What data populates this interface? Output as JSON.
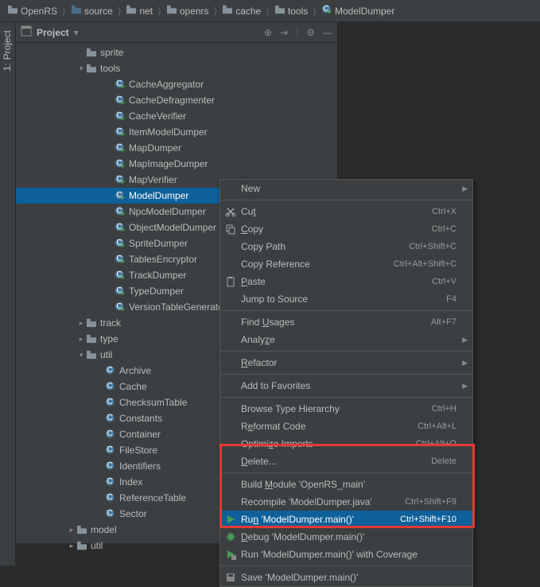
{
  "breadcrumb": [
    {
      "icon": "folder",
      "label": "OpenRS"
    },
    {
      "icon": "folder-src",
      "label": "source"
    },
    {
      "icon": "folder",
      "label": "net"
    },
    {
      "icon": "folder",
      "label": "openrs"
    },
    {
      "icon": "folder",
      "label": "cache"
    },
    {
      "icon": "folder",
      "label": "tools"
    },
    {
      "icon": "class-run",
      "label": "ModelDumper"
    }
  ],
  "sidebar_tab": {
    "index": "1:",
    "label": "Project"
  },
  "panel": {
    "title": "Project"
  },
  "tree": [
    {
      "indent": 76,
      "expand": "",
      "icon": "folder",
      "label": "sprite",
      "sel": false
    },
    {
      "indent": 76,
      "expand": "▾",
      "icon": "folder",
      "label": "tools",
      "sel": false
    },
    {
      "indent": 112,
      "expand": "",
      "icon": "class-run",
      "label": "CacheAggregator",
      "sel": false
    },
    {
      "indent": 112,
      "expand": "",
      "icon": "class-run",
      "label": "CacheDefragmenter",
      "sel": false
    },
    {
      "indent": 112,
      "expand": "",
      "icon": "class-run",
      "label": "CacheVerifier",
      "sel": false
    },
    {
      "indent": 112,
      "expand": "",
      "icon": "class-run",
      "label": "ItemModelDumper",
      "sel": false
    },
    {
      "indent": 112,
      "expand": "",
      "icon": "class-run",
      "label": "MapDumper",
      "sel": false
    },
    {
      "indent": 112,
      "expand": "",
      "icon": "class-run",
      "label": "MapImageDumper",
      "sel": false
    },
    {
      "indent": 112,
      "expand": "",
      "icon": "class-run",
      "label": "MapVerifier",
      "sel": false
    },
    {
      "indent": 112,
      "expand": "",
      "icon": "class-run",
      "label": "ModelDumper",
      "sel": true
    },
    {
      "indent": 112,
      "expand": "",
      "icon": "class-run",
      "label": "NpcModelDumper",
      "sel": false
    },
    {
      "indent": 112,
      "expand": "",
      "icon": "class-run",
      "label": "ObjectModelDumper",
      "sel": false
    },
    {
      "indent": 112,
      "expand": "",
      "icon": "class-run",
      "label": "SpriteDumper",
      "sel": false
    },
    {
      "indent": 112,
      "expand": "",
      "icon": "class-run",
      "label": "TablesEncryptor",
      "sel": false
    },
    {
      "indent": 112,
      "expand": "",
      "icon": "class-run",
      "label": "TrackDumper",
      "sel": false
    },
    {
      "indent": 112,
      "expand": "",
      "icon": "class-run",
      "label": "TypeDumper",
      "sel": false
    },
    {
      "indent": 112,
      "expand": "",
      "icon": "class-run",
      "label": "VersionTableGenerator",
      "sel": false
    },
    {
      "indent": 76,
      "expand": "▸",
      "icon": "folder",
      "label": "track",
      "sel": false
    },
    {
      "indent": 76,
      "expand": "▸",
      "icon": "folder",
      "label": "type",
      "sel": false
    },
    {
      "indent": 76,
      "expand": "▾",
      "icon": "folder",
      "label": "util",
      "sel": false
    },
    {
      "indent": 100,
      "expand": "",
      "icon": "class",
      "label": "Archive",
      "sel": false
    },
    {
      "indent": 100,
      "expand": "",
      "icon": "class",
      "label": "Cache",
      "sel": false
    },
    {
      "indent": 100,
      "expand": "",
      "icon": "class",
      "label": "ChecksumTable",
      "sel": false
    },
    {
      "indent": 100,
      "expand": "",
      "icon": "class",
      "label": "Constants",
      "sel": false
    },
    {
      "indent": 100,
      "expand": "",
      "icon": "class",
      "label": "Container",
      "sel": false
    },
    {
      "indent": 100,
      "expand": "",
      "icon": "class",
      "label": "FileStore",
      "sel": false
    },
    {
      "indent": 100,
      "expand": "",
      "icon": "class",
      "label": "Identifiers",
      "sel": false
    },
    {
      "indent": 100,
      "expand": "",
      "icon": "class",
      "label": "Index",
      "sel": false
    },
    {
      "indent": 100,
      "expand": "",
      "icon": "class",
      "label": "ReferenceTable",
      "sel": false
    },
    {
      "indent": 100,
      "expand": "",
      "icon": "class",
      "label": "Sector",
      "sel": false
    },
    {
      "indent": 64,
      "expand": "▸",
      "icon": "folder",
      "label": "model",
      "sel": false
    },
    {
      "indent": 64,
      "expand": "▸",
      "icon": "folder",
      "label": "util",
      "sel": false
    }
  ],
  "context_menu": [
    {
      "type": "item",
      "label": "New",
      "submenu": true
    },
    {
      "type": "sep"
    },
    {
      "type": "item",
      "icon": "cut",
      "label_html": "Cu<u>t</u>",
      "shortcut": "Ctrl+X"
    },
    {
      "type": "item",
      "icon": "copy",
      "label_html": "<u>C</u>opy",
      "shortcut": "Ctrl+C"
    },
    {
      "type": "item",
      "label": "Copy Path",
      "shortcut": "Ctrl+Shift+C"
    },
    {
      "type": "item",
      "label": "Copy Reference",
      "shortcut": "Ctrl+Alt+Shift+C"
    },
    {
      "type": "item",
      "icon": "paste",
      "label_html": "<u>P</u>aste",
      "shortcut": "Ctrl+V"
    },
    {
      "type": "item",
      "label": "Jump to Source",
      "shortcut": "F4"
    },
    {
      "type": "sep"
    },
    {
      "type": "item",
      "label_html": "Find <u>U</u>sages",
      "shortcut": "Alt+F7"
    },
    {
      "type": "item",
      "label_html": "Analy<u>z</u>e",
      "submenu": true
    },
    {
      "type": "sep"
    },
    {
      "type": "item",
      "label_html": "<u>R</u>efactor",
      "submenu": true
    },
    {
      "type": "sep"
    },
    {
      "type": "item",
      "label": "Add to Favorites",
      "submenu": true
    },
    {
      "type": "sep"
    },
    {
      "type": "item",
      "label": "Browse Type Hierarchy",
      "shortcut": "Ctrl+H"
    },
    {
      "type": "item",
      "label_html": "R<u>e</u>format Code",
      "shortcut": "Ctrl+Alt+L"
    },
    {
      "type": "item",
      "label_html": "Optimi<u>z</u>e Imports",
      "shortcut": "Ctrl+Alt+O"
    },
    {
      "type": "item",
      "label_html": "<u>D</u>elete...",
      "shortcut": "Delete"
    },
    {
      "type": "sep"
    },
    {
      "type": "item",
      "label_html": "Build <u>M</u>odule 'OpenRS_main'"
    },
    {
      "type": "item",
      "label": "Recompile 'ModelDumper.java'",
      "shortcut": "Ctrl+Shift+F9"
    },
    {
      "type": "item",
      "icon": "run",
      "label_html": "Ru<u>n</u> 'ModelDumper.main()'",
      "shortcut": "Ctrl+Shift+F10",
      "hover": true
    },
    {
      "type": "item",
      "icon": "debug",
      "label_html": "<u>D</u>ebug 'ModelDumper.main()'"
    },
    {
      "type": "item",
      "icon": "coverage",
      "label": "Run 'ModelDumper.main()' with Coverage"
    },
    {
      "type": "sep"
    },
    {
      "type": "item",
      "icon": "disk",
      "label": "Save 'ModelDumper.main()'"
    }
  ]
}
